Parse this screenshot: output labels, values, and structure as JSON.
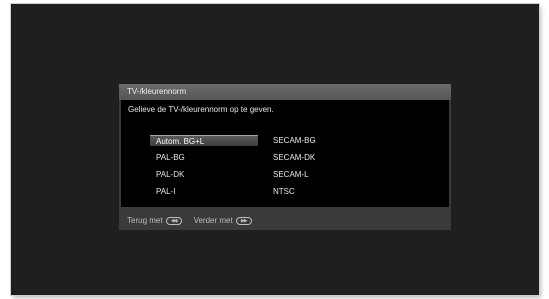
{
  "dialog": {
    "title": "TV-/kleurennorm",
    "prompt": "Gelieve de TV-/kleurennorm op te geven.",
    "options_left": [
      "Autom. BG+L",
      "PAL-BG",
      "PAL-DK",
      "PAL-I"
    ],
    "options_right": [
      "SECAM-BG",
      "SECAM-DK",
      "SECAM-L",
      "NTSC"
    ],
    "selected": "Autom. BG+L"
  },
  "footer": {
    "back_label": "Terug met",
    "back_icon": "rewind-icon",
    "next_label": "Verder met",
    "next_icon": "fast-forward-icon"
  }
}
